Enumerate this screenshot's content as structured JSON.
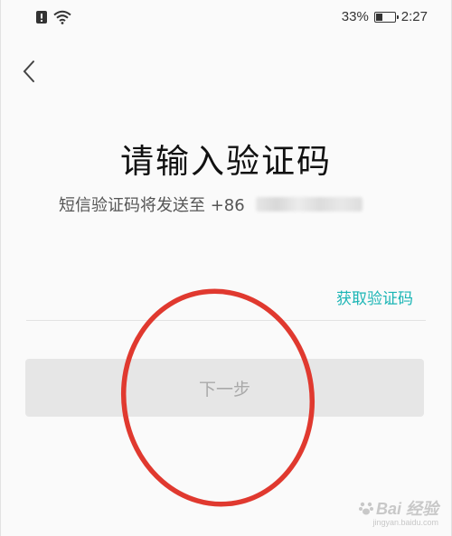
{
  "status_bar": {
    "battery_percent": "33%",
    "battery_level": 0.33,
    "time": "2:27",
    "icons": [
      "alert-sim-icon",
      "wifi-icon",
      "battery-icon"
    ]
  },
  "nav": {
    "back_icon": "chevron-left-icon"
  },
  "title": "请输入验证码",
  "subtitle": {
    "text": "短信验证码将发送至 +86"
  },
  "code_row": {
    "input_value": "",
    "input_placeholder": "",
    "get_code_label": "获取验证码"
  },
  "next_button": {
    "label": "下一步"
  },
  "annotation": {
    "color": "#e0392f"
  },
  "watermark": {
    "brand": "Bai 经验",
    "url": "jingyan.baidu.com"
  },
  "colors": {
    "accent": "#1bb5b5",
    "button_bg": "#e6e6e6",
    "button_text": "#a9a9a9"
  }
}
